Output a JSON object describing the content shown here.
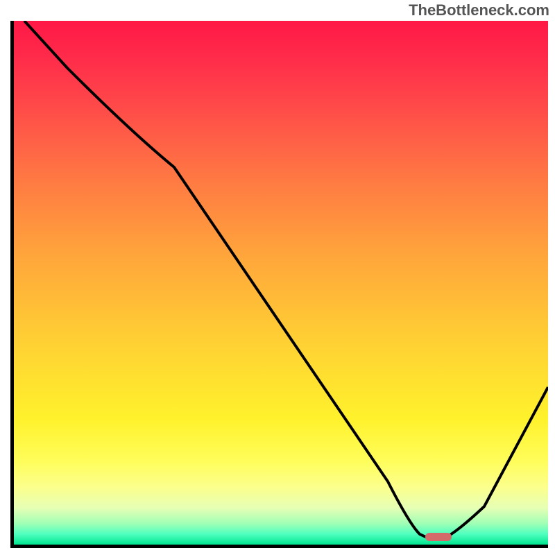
{
  "watermark": "TheBottleneck.com",
  "chart_data": {
    "type": "line",
    "title": "",
    "xlabel": "",
    "ylabel": "",
    "xlim": [
      0,
      100
    ],
    "ylim": [
      0,
      100
    ],
    "series": [
      {
        "name": "bottleneck_curve",
        "x": [
          2,
          10,
          22,
          30,
          40,
          50,
          60,
          70,
          74,
          78,
          82,
          88,
          100
        ],
        "values": [
          100,
          91,
          79,
          72,
          58,
          44,
          30,
          12,
          3,
          1,
          1,
          7,
          30
        ]
      }
    ],
    "gradient_stops": [
      {
        "pct": 0,
        "color": "#ff1846"
      },
      {
        "pct": 30,
        "color": "#ff7843"
      },
      {
        "pct": 62,
        "color": "#ffd233"
      },
      {
        "pct": 89,
        "color": "#fcff8c"
      },
      {
        "pct": 100,
        "color": "#00e68f"
      }
    ],
    "optimal_marker": {
      "x": 80,
      "y": 1
    }
  }
}
